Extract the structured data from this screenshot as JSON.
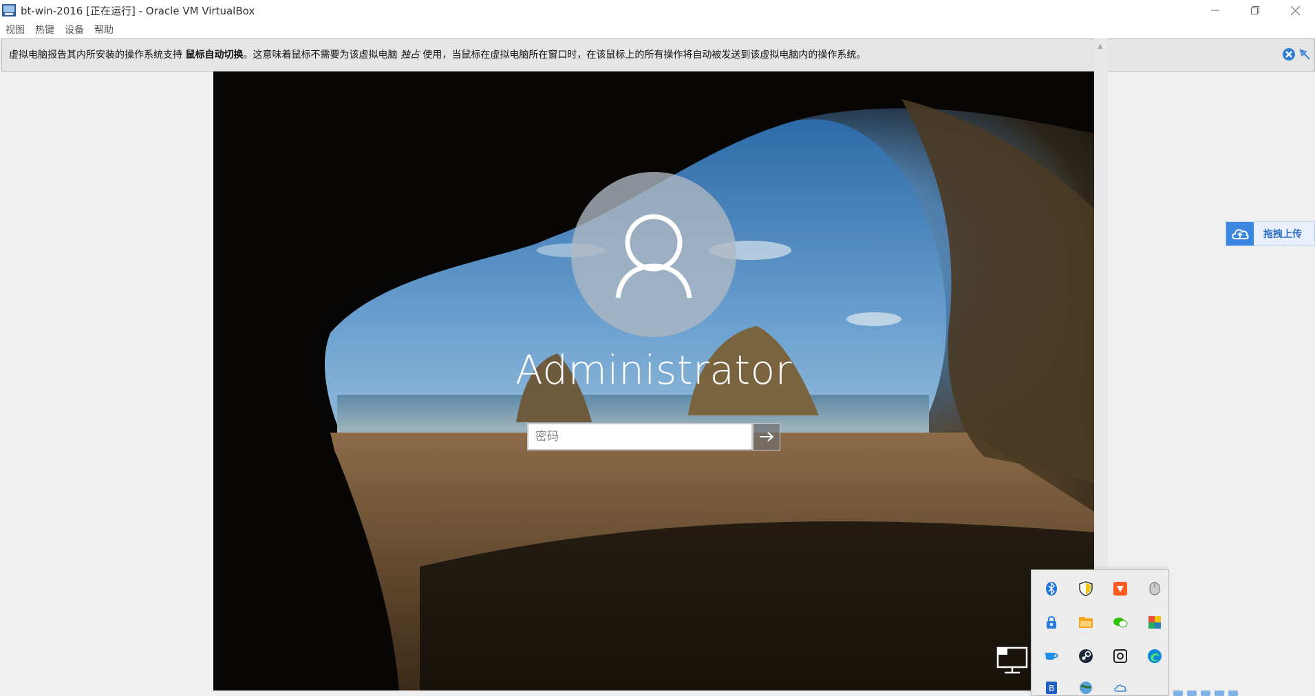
{
  "window": {
    "title": "bt-win-2016 [正在运行] - Oracle VM VirtualBox"
  },
  "menu": {
    "items": [
      "视图",
      "热键",
      "设备",
      "帮助"
    ]
  },
  "notification": {
    "text_before": "虚拟电脑报告其内所安装的操作系统支持 ",
    "bold": "鼠标自动切换",
    "text_mid": "。这意味着鼠标不需要为该虚拟电脑 ",
    "italic": "独占",
    "text_after": " 使用，当鼠标在虚拟电脑所在窗口时，在该鼠标上的所有操作将自动被发送到该虚拟电脑内的操作系统。"
  },
  "login": {
    "user_name": "Administrator",
    "password_placeholder": "密码",
    "password_value": ""
  },
  "upload": {
    "label": "拖拽上传"
  },
  "tray": {
    "icons": [
      "bluetooth-icon",
      "shield-icon",
      "app-red-icon",
      "mouse-icon",
      "lock-icon",
      "folder-icon",
      "wechat-icon",
      "colors-icon",
      "cup-icon",
      "steam-icon",
      "capture-icon",
      "edge-icon",
      "bt-icon",
      "globe-icon",
      "cloud-icon"
    ]
  },
  "colors": {
    "accent": "#3a86e0",
    "banner_bg": "#e5e5e5"
  }
}
